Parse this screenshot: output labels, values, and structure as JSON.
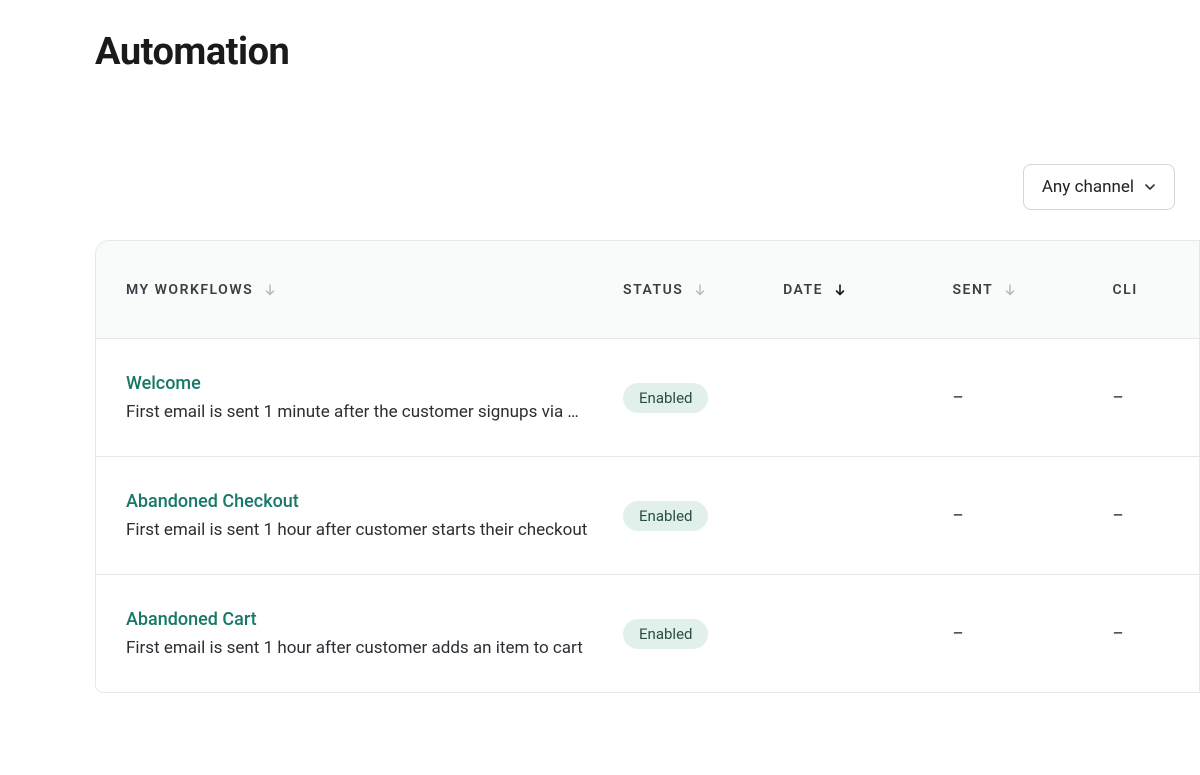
{
  "page": {
    "title": "Automation"
  },
  "filters": {
    "channel": {
      "label": "Any channel"
    }
  },
  "columns": {
    "workflows": "My Workflows",
    "status": "Status",
    "date": "Date",
    "sent": "Sent",
    "click": "CLI"
  },
  "workflows": [
    {
      "name": "Welcome",
      "description": "First email is sent 1 minute after the customer signups via …",
      "status": "Enabled",
      "date": "",
      "sent": "–",
      "click": "–"
    },
    {
      "name": "Abandoned Checkout",
      "description": "First email is sent 1 hour after customer starts their checkout",
      "status": "Enabled",
      "date": "",
      "sent": "–",
      "click": "–"
    },
    {
      "name": "Abandoned Cart",
      "description": "First email is sent 1 hour after customer adds an item to cart",
      "status": "Enabled",
      "date": "",
      "sent": "–",
      "click": "–"
    }
  ]
}
